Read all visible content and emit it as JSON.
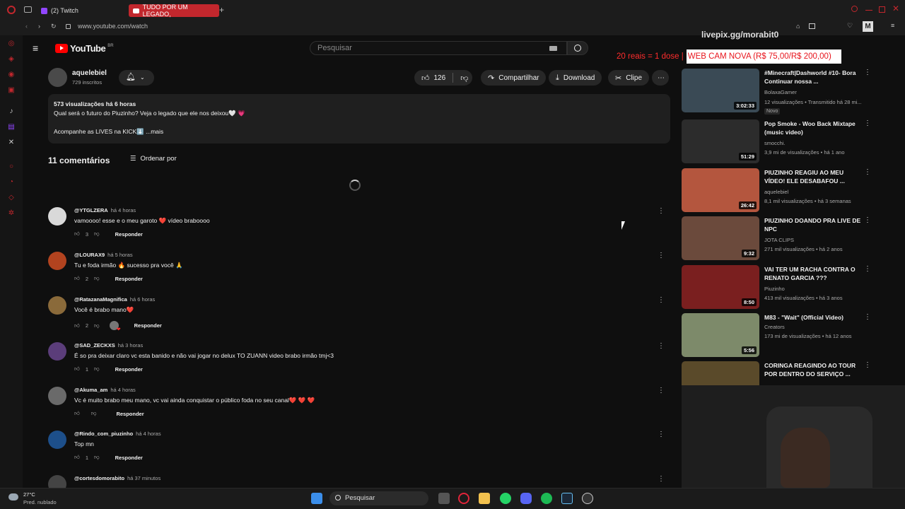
{
  "browser": {
    "tabs": [
      {
        "label": "(2) Twitch"
      },
      {
        "label": "TUDO POR UM LEGADO,"
      }
    ],
    "url": "www.youtube.com/watch"
  },
  "youtube": {
    "logo": "YouTube",
    "region": "BR",
    "search_placeholder": "Pesquisar"
  },
  "overlay": {
    "livepix": "livepix.gg/morabit0",
    "banner_red": "20 reais = 1 dose |",
    "banner_white": "WEB CAM NOVA (R$ 75,00/R$ 200,00)"
  },
  "channel": {
    "name": "aquelebiel",
    "subscribers": "729 inscritos",
    "likes": "126",
    "share_label": "Compartilhar",
    "download_label": "Download",
    "clip_label": "Clipe"
  },
  "description": {
    "stats": "573 visualizações  há 6 horas",
    "line1": "Qual será o futuro do Piuzinho? Veja o legado que ele nos deixou🤍 💗",
    "line2": "Acompanhe as LIVES na KICK⬇️  ...mais"
  },
  "comments_header": {
    "count": "11 comentários",
    "sort_label": "Ordenar por"
  },
  "comments": [
    {
      "author": "@YTGLZERA",
      "time": "há 4 horas",
      "text": "vamoooo! esse e o meu garoto ❤️ vídeo braboooo",
      "likes": "3",
      "reply": "Responder",
      "avatar_color": "#d9d9d9"
    },
    {
      "author": "@LOURAX9",
      "time": "há 5 horas",
      "text": "Tu e foda irmão 🔥 sucesso pra você 🙏",
      "likes": "2",
      "reply": "Responder",
      "avatar_color": "#b2431f"
    },
    {
      "author": "@RatazanaMagnifica",
      "time": "há 6 horas",
      "text": "Você é brabo mano❤️",
      "likes": "2",
      "reply": "Responder",
      "avatar_color": "#8a6a3a"
    },
    {
      "author": "@SAD_ZECKXS",
      "time": "há 3 horas",
      "text": "É so pra deixar claro vc esta banido e não vai jogar no delux TO ZUANN video brabo irmão tmj<3",
      "likes": "1",
      "reply": "Responder",
      "avatar_color": "#5b3d7a"
    },
    {
      "author": "@Akuma_am",
      "time": "há 4 horas",
      "text": "Vc é muito brabo meu mano, vc vai ainda conquistar o público foda no seu canal❤️ ❤️ ❤️",
      "likes": "",
      "reply": "Responder",
      "avatar_color": "#6a6a6a"
    },
    {
      "author": "@Rindo_com_piuzinho",
      "time": "há 4 horas",
      "text": "Top mn",
      "likes": "1",
      "reply": "Responder",
      "avatar_color": "#1d4f8a"
    },
    {
      "author": "@cortesdomorabito",
      "time": "há 37 minutos",
      "text": "",
      "likes": "",
      "reply": "",
      "avatar_color": "#444444"
    }
  ],
  "related": [
    {
      "title": "#Minecraft|Dashworld #10- Bora Continuar nossa ...",
      "channel": "BolaxaGamer",
      "meta": "12 visualizações • Transmitido há 28 mi...",
      "badge": "Novo",
      "duration": "3:02:33",
      "thumb_color": "#3a4a55"
    },
    {
      "title": "Pop Smoke - Woo Back Mixtape (music video)",
      "channel": "smocchi.",
      "meta": "3,9 mi de visualizações • há 1 ano",
      "badge": "",
      "duration": "51:29",
      "thumb_color": "#2c2c2c"
    },
    {
      "title": "PIUZINHO REAGIU AO MEU VÍDEO! ELE DESABAFOU ...",
      "channel": "aquelebiel",
      "meta": "8,1 mil visualizações • há 3 semanas",
      "badge": "",
      "duration": "26:42",
      "thumb_color": "#b4563e"
    },
    {
      "title": "PIUZINHO DOANDO PRA LIVE DE NPC",
      "channel": "JOTA CLIPS",
      "meta": "271 mil visualizações • há 2 anos",
      "badge": "",
      "duration": "9:32",
      "thumb_color": "#6b4a3c"
    },
    {
      "title": "VAI TER UM RACHA CONTRA O RENATO GARCIA ???",
      "channel": "Piuzinho",
      "meta": "413 mil visualizações • há 3 anos",
      "badge": "",
      "duration": "8:50",
      "thumb_color": "#7a1f1f"
    },
    {
      "title": "M83 - \"Wait\" (Official Video)",
      "channel": "Creators",
      "meta": "173 mi de visualizações • há 12 anos",
      "badge": "",
      "duration": "5:56",
      "thumb_color": "#7d8a6a"
    },
    {
      "title": "CORINGA REAGINDO AO TOUR POR DENTRO DO SERVIÇO ...",
      "channel": "",
      "meta": "",
      "badge": "",
      "duration": "",
      "thumb_color": "#5a4a2a"
    }
  ],
  "taskbar": {
    "weather_temp": "27°C",
    "weather_desc": "Pred. nublado",
    "search_label": "Pesquisar"
  }
}
